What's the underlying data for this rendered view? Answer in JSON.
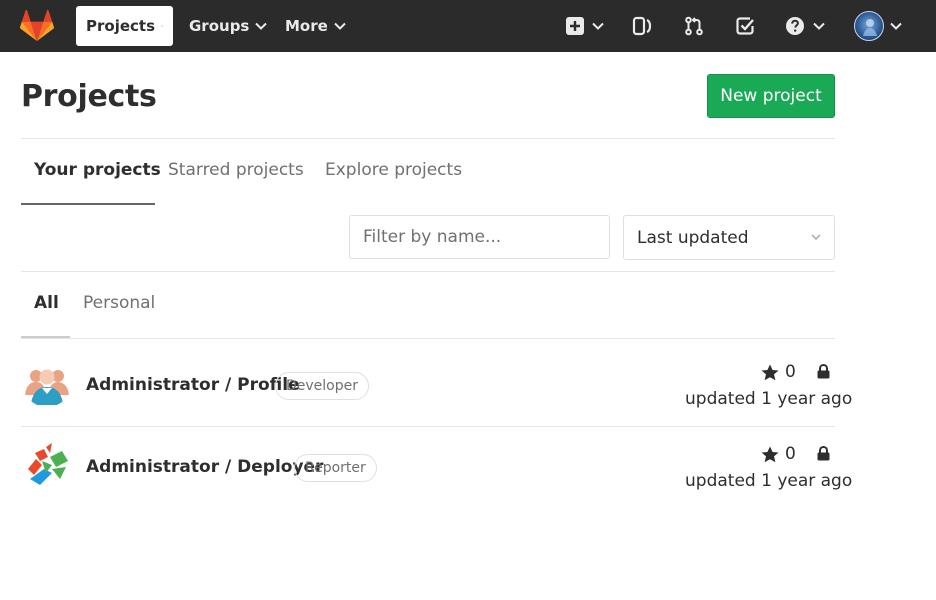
{
  "navbar": {
    "brand_color": "#e24329",
    "projects_label": "Projects",
    "groups_label": "Groups",
    "more_label": "More",
    "icons": [
      "plus-square-icon",
      "issues-icon",
      "merge-request-icon",
      "todo-check-icon",
      "help-icon",
      "user-avatar"
    ]
  },
  "header": {
    "title": "Projects",
    "new_project_label": "New project"
  },
  "tabs": {
    "your_projects": "Your projects",
    "starred_projects": "Starred projects",
    "explore_projects": "Explore projects"
  },
  "filter": {
    "placeholder": "Filter by name...",
    "sort_selected": "Last updated"
  },
  "subtabs": {
    "all": "All",
    "personal": "Personal"
  },
  "projects": [
    {
      "name": "Administrator / Profile",
      "role": "Developer",
      "stars": "0",
      "updated": "updated 1 year ago",
      "visibility": "private"
    },
    {
      "name": "Administrator / Deployer",
      "role": "Reporter",
      "stars": "0",
      "updated": "updated 1 year ago",
      "visibility": "private"
    }
  ],
  "colors": {
    "navbar_bg": "#2b2b2b",
    "primary_button": "#1aaa55"
  }
}
